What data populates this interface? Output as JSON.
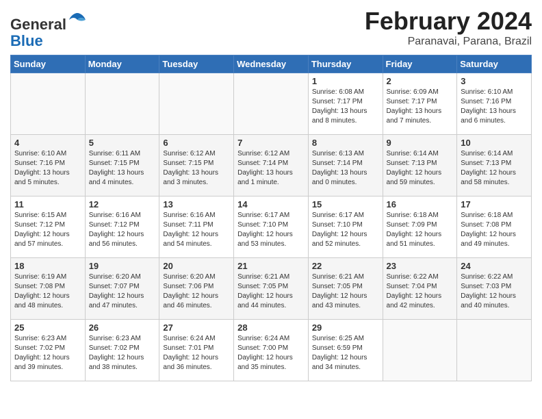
{
  "header": {
    "logo_general": "General",
    "logo_blue": "Blue",
    "main_title": "February 2024",
    "subtitle": "Paranavai, Parana, Brazil"
  },
  "weekdays": [
    "Sunday",
    "Monday",
    "Tuesday",
    "Wednesday",
    "Thursday",
    "Friday",
    "Saturday"
  ],
  "weeks": [
    [
      {
        "day": "",
        "info": ""
      },
      {
        "day": "",
        "info": ""
      },
      {
        "day": "",
        "info": ""
      },
      {
        "day": "",
        "info": ""
      },
      {
        "day": "1",
        "sunrise": "6:08 AM",
        "sunset": "7:17 PM",
        "daylight": "13 hours and 8 minutes."
      },
      {
        "day": "2",
        "sunrise": "6:09 AM",
        "sunset": "7:17 PM",
        "daylight": "13 hours and 7 minutes."
      },
      {
        "day": "3",
        "sunrise": "6:10 AM",
        "sunset": "7:16 PM",
        "daylight": "13 hours and 6 minutes."
      }
    ],
    [
      {
        "day": "4",
        "sunrise": "6:10 AM",
        "sunset": "7:16 PM",
        "daylight": "13 hours and 5 minutes."
      },
      {
        "day": "5",
        "sunrise": "6:11 AM",
        "sunset": "7:15 PM",
        "daylight": "13 hours and 4 minutes."
      },
      {
        "day": "6",
        "sunrise": "6:12 AM",
        "sunset": "7:15 PM",
        "daylight": "13 hours and 3 minutes."
      },
      {
        "day": "7",
        "sunrise": "6:12 AM",
        "sunset": "7:14 PM",
        "daylight": "13 hours and 1 minute."
      },
      {
        "day": "8",
        "sunrise": "6:13 AM",
        "sunset": "7:14 PM",
        "daylight": "13 hours and 0 minutes."
      },
      {
        "day": "9",
        "sunrise": "6:14 AM",
        "sunset": "7:13 PM",
        "daylight": "12 hours and 59 minutes."
      },
      {
        "day": "10",
        "sunrise": "6:14 AM",
        "sunset": "7:13 PM",
        "daylight": "12 hours and 58 minutes."
      }
    ],
    [
      {
        "day": "11",
        "sunrise": "6:15 AM",
        "sunset": "7:12 PM",
        "daylight": "12 hours and 57 minutes."
      },
      {
        "day": "12",
        "sunrise": "6:16 AM",
        "sunset": "7:12 PM",
        "daylight": "12 hours and 56 minutes."
      },
      {
        "day": "13",
        "sunrise": "6:16 AM",
        "sunset": "7:11 PM",
        "daylight": "12 hours and 54 minutes."
      },
      {
        "day": "14",
        "sunrise": "6:17 AM",
        "sunset": "7:10 PM",
        "daylight": "12 hours and 53 minutes."
      },
      {
        "day": "15",
        "sunrise": "6:17 AM",
        "sunset": "7:10 PM",
        "daylight": "12 hours and 52 minutes."
      },
      {
        "day": "16",
        "sunrise": "6:18 AM",
        "sunset": "7:09 PM",
        "daylight": "12 hours and 51 minutes."
      },
      {
        "day": "17",
        "sunrise": "6:18 AM",
        "sunset": "7:08 PM",
        "daylight": "12 hours and 49 minutes."
      }
    ],
    [
      {
        "day": "18",
        "sunrise": "6:19 AM",
        "sunset": "7:08 PM",
        "daylight": "12 hours and 48 minutes."
      },
      {
        "day": "19",
        "sunrise": "6:20 AM",
        "sunset": "7:07 PM",
        "daylight": "12 hours and 47 minutes."
      },
      {
        "day": "20",
        "sunrise": "6:20 AM",
        "sunset": "7:06 PM",
        "daylight": "12 hours and 46 minutes."
      },
      {
        "day": "21",
        "sunrise": "6:21 AM",
        "sunset": "7:05 PM",
        "daylight": "12 hours and 44 minutes."
      },
      {
        "day": "22",
        "sunrise": "6:21 AM",
        "sunset": "7:05 PM",
        "daylight": "12 hours and 43 minutes."
      },
      {
        "day": "23",
        "sunrise": "6:22 AM",
        "sunset": "7:04 PM",
        "daylight": "12 hours and 42 minutes."
      },
      {
        "day": "24",
        "sunrise": "6:22 AM",
        "sunset": "7:03 PM",
        "daylight": "12 hours and 40 minutes."
      }
    ],
    [
      {
        "day": "25",
        "sunrise": "6:23 AM",
        "sunset": "7:02 PM",
        "daylight": "12 hours and 39 minutes."
      },
      {
        "day": "26",
        "sunrise": "6:23 AM",
        "sunset": "7:02 PM",
        "daylight": "12 hours and 38 minutes."
      },
      {
        "day": "27",
        "sunrise": "6:24 AM",
        "sunset": "7:01 PM",
        "daylight": "12 hours and 36 minutes."
      },
      {
        "day": "28",
        "sunrise": "6:24 AM",
        "sunset": "7:00 PM",
        "daylight": "12 hours and 35 minutes."
      },
      {
        "day": "29",
        "sunrise": "6:25 AM",
        "sunset": "6:59 PM",
        "daylight": "12 hours and 34 minutes."
      },
      {
        "day": "",
        "info": ""
      },
      {
        "day": "",
        "info": ""
      }
    ]
  ]
}
